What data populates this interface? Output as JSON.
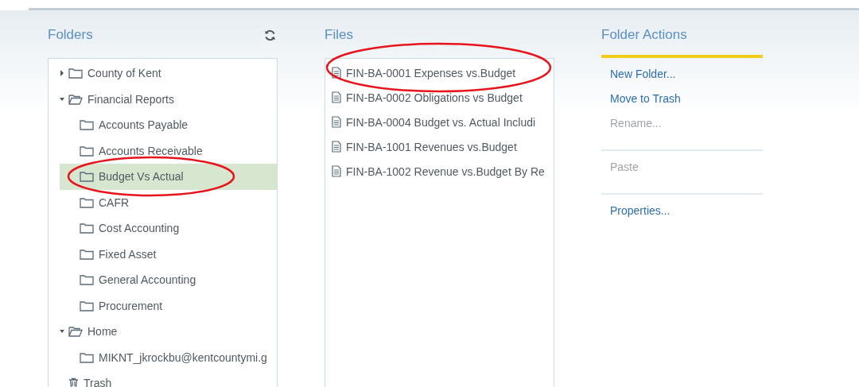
{
  "folders": {
    "title": "Folders",
    "tree": [
      {
        "label": "County of Kent",
        "kind": "folder",
        "expanded": false,
        "selected": false
      },
      {
        "label": "Financial Reports",
        "kind": "folder",
        "expanded": true,
        "selected": false,
        "children": [
          {
            "label": "Accounts Payable",
            "kind": "folder",
            "selected": false
          },
          {
            "label": "Accounts Receivable",
            "kind": "folder",
            "selected": false
          },
          {
            "label": "Budget Vs Actual",
            "kind": "folder",
            "selected": true
          },
          {
            "label": "CAFR",
            "kind": "folder",
            "selected": false
          },
          {
            "label": "Cost Accounting",
            "kind": "folder",
            "selected": false
          },
          {
            "label": "Fixed Asset",
            "kind": "folder",
            "selected": false
          },
          {
            "label": "General Accounting",
            "kind": "folder",
            "selected": false
          },
          {
            "label": "Procurement",
            "kind": "folder",
            "selected": false
          }
        ]
      },
      {
        "label": "Home",
        "kind": "folder",
        "expanded": true,
        "selected": false,
        "children": [
          {
            "label": "MIKNT_jkrockbu@kentcountymi.g",
            "kind": "folder",
            "selected": false
          }
        ]
      },
      {
        "label": "Trash",
        "kind": "trash",
        "selected": false
      }
    ]
  },
  "files": {
    "title": "Files",
    "items": [
      {
        "label": "FIN-BA-0001 Expenses vs.Budget"
      },
      {
        "label": "FIN-BA-0002 Obligations vs Budget"
      },
      {
        "label": "FIN-BA-0004 Budget vs. Actual Includi"
      },
      {
        "label": "FIN-BA-1001 Revenues vs.Budget"
      },
      {
        "label": "FIN-BA-1002 Revenue vs.Budget By Re"
      }
    ]
  },
  "actions": {
    "title": "Folder Actions",
    "groups": [
      [
        {
          "label": "New Folder...",
          "disabled": false
        },
        {
          "label": "Move to Trash",
          "disabled": false
        },
        {
          "label": "Rename...",
          "disabled": true
        }
      ],
      [
        {
          "label": "Paste",
          "disabled": true
        }
      ],
      [
        {
          "label": "Properties...",
          "disabled": false
        }
      ]
    ]
  }
}
